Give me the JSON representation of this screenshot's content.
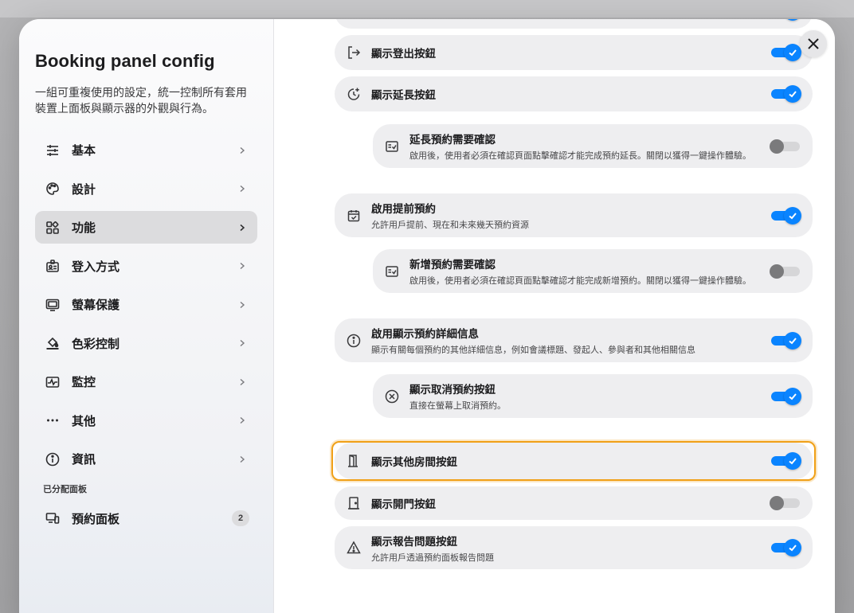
{
  "sidebar": {
    "title": "Booking panel config",
    "description": "一組可重複使用的設定，統一控制所有套用裝置上面板與顯示器的外觀與行為。",
    "items": [
      {
        "label": "基本",
        "icon": "sliders-icon"
      },
      {
        "label": "設計",
        "icon": "palette-icon"
      },
      {
        "label": "功能",
        "icon": "grid-icon",
        "active": true
      },
      {
        "label": "登入方式",
        "icon": "badge-icon"
      },
      {
        "label": "螢幕保護",
        "icon": "monitor-icon"
      },
      {
        "label": "色彩控制",
        "icon": "paint-bucket-icon"
      },
      {
        "label": "監控",
        "icon": "pulse-icon"
      },
      {
        "label": "其他",
        "icon": "more-icon"
      },
      {
        "label": "資訊",
        "icon": "info-icon"
      }
    ],
    "assigned_section": "已分配面板",
    "assigned": {
      "label": "預約面板",
      "count": "2"
    }
  },
  "settings": [
    {
      "title": "顯示登出按鈕",
      "subtitle": "",
      "enabled": true,
      "icon": "logout-icon"
    },
    {
      "title": "顯示延長按鈕",
      "subtitle": "",
      "enabled": true,
      "icon": "clock-plus-icon"
    },
    {
      "title": "延長預約需要確認",
      "subtitle": "啟用後，使用者必須在確認頁面點擊確認才能完成預約延長。關閉以獲得一鍵操作體驗。",
      "enabled": false,
      "icon": "confirm-card-icon",
      "nested": true
    },
    {
      "title": "啟用提前預約",
      "subtitle": "允許用戶提前、現在和未來幾天預約資源",
      "enabled": true,
      "icon": "calendar-check-icon"
    },
    {
      "title": "新增預約需要確認",
      "subtitle": "啟用後，使用者必須在確認頁面點擊確認才能完成新增預約。關閉以獲得一鍵操作體驗。",
      "enabled": false,
      "icon": "confirm-card-icon",
      "nested": true
    },
    {
      "title": "啟用顯示預約詳細信息",
      "subtitle": "顯示有關每個預約的其他詳細信息，例如會議標題、發起人、參與者和其他相關信息",
      "enabled": true,
      "icon": "info-icon"
    },
    {
      "title": "顯示取消預約按鈕",
      "subtitle": "直接在螢幕上取消預約。",
      "enabled": true,
      "icon": "cancel-circle-icon",
      "nested": true
    },
    {
      "title": "顯示其他房間按鈕",
      "subtitle": "",
      "enabled": true,
      "icon": "door-open-icon",
      "highlighted": true
    },
    {
      "title": "顯示開門按鈕",
      "subtitle": "",
      "enabled": false,
      "icon": "door-icon"
    },
    {
      "title": "顯示報告問題按鈕",
      "subtitle": "允許用戶透過預約面板報告問題",
      "enabled": true,
      "icon": "warning-icon"
    }
  ],
  "colors": {
    "accent": "#0a84ff",
    "highlight": "#f0a017"
  }
}
